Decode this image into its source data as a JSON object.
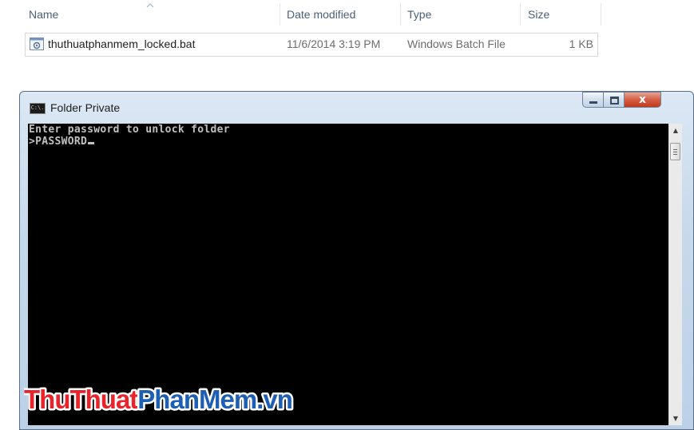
{
  "explorer": {
    "columns": {
      "name": "Name",
      "date": "Date modified",
      "type": "Type",
      "size": "Size"
    },
    "file": {
      "name": "thuthuatphanmem_locked.bat",
      "date": "11/6/2014 3:19 PM",
      "type": "Windows Batch File",
      "size": "1 KB",
      "icon": "batch-file-icon"
    }
  },
  "cmd_window": {
    "title": "Folder Private",
    "title_icon_text": "C:\\.",
    "lines": [
      "Enter password to unlock folder",
      ">PASSWORD"
    ],
    "controls": {
      "close_glyph": "x"
    }
  },
  "watermark": {
    "text": "ThuThuatPhanMem.vn",
    "part1": "ThuThuat",
    "part2": "PhanMem",
    "part3": ".vn"
  },
  "colors": {
    "console_bg": "#000000",
    "console_text": "#c0c0c0",
    "watermark_red": "#e8232a",
    "watermark_blue": "#1e5fb4",
    "close_button": "#c9462a"
  }
}
